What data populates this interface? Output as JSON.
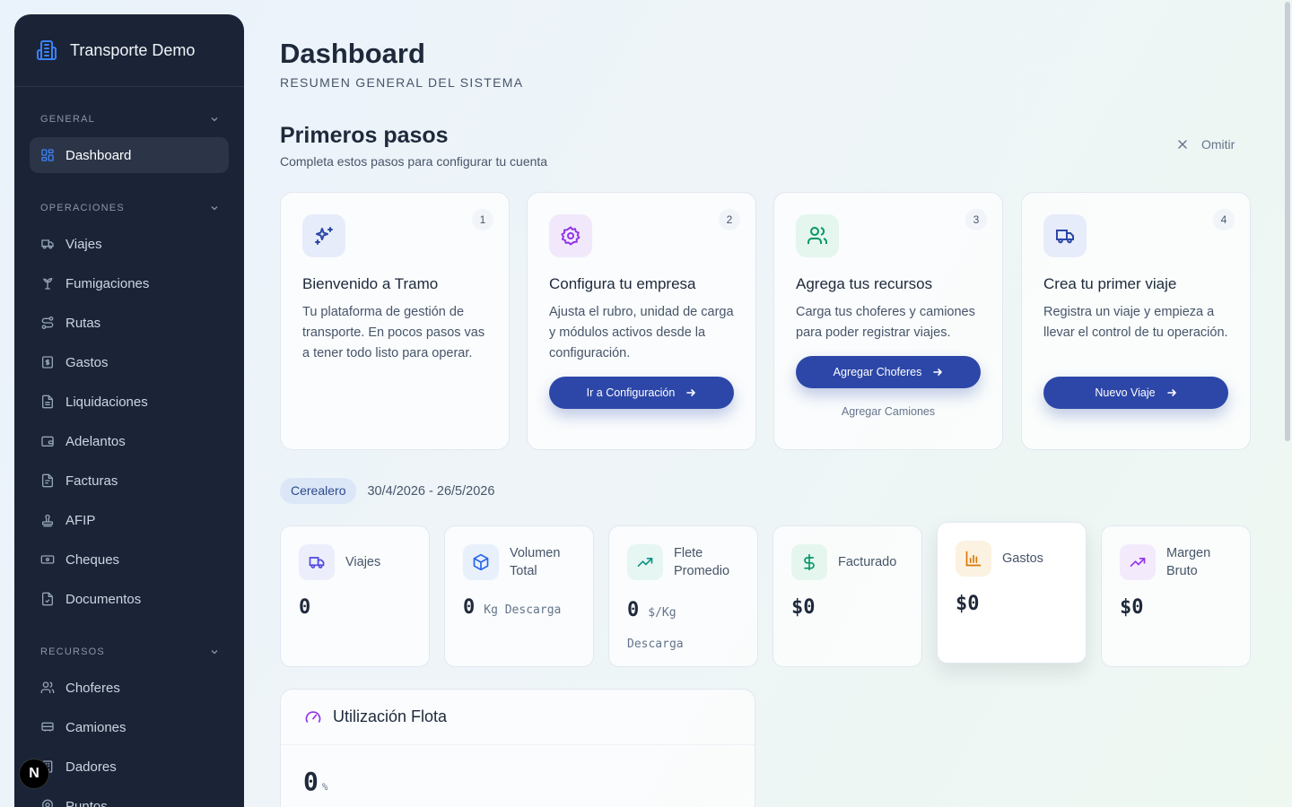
{
  "sidebar": {
    "brand": "Transporte Demo",
    "sections": [
      {
        "title": "GENERAL",
        "items": [
          {
            "label": "Dashboard",
            "icon": "layout-grid-icon",
            "active": true
          }
        ]
      },
      {
        "title": "OPERACIONES",
        "items": [
          {
            "label": "Viajes",
            "icon": "truck-icon"
          },
          {
            "label": "Fumigaciones",
            "icon": "spray-icon"
          },
          {
            "label": "Rutas",
            "icon": "route-icon"
          },
          {
            "label": "Gastos",
            "icon": "receipt-icon"
          },
          {
            "label": "Liquidaciones",
            "icon": "document-icon"
          },
          {
            "label": "Adelantos",
            "icon": "wallet-icon"
          },
          {
            "label": "Facturas",
            "icon": "invoice-icon"
          },
          {
            "label": "AFIP",
            "icon": "stamp-icon"
          },
          {
            "label": "Cheques",
            "icon": "cheque-icon"
          },
          {
            "label": "Documentos",
            "icon": "file-icon"
          }
        ]
      },
      {
        "title": "RECURSOS",
        "items": [
          {
            "label": "Choferes",
            "icon": "users-icon"
          },
          {
            "label": "Camiones",
            "icon": "bus-icon"
          },
          {
            "label": "Dadores",
            "icon": "building-icon"
          },
          {
            "label": "Puntos",
            "icon": "map-pin-icon"
          }
        ]
      }
    ]
  },
  "header": {
    "title": "Dashboard",
    "subtitle": "RESUMEN GENERAL DEL SISTEMA"
  },
  "onboarding": {
    "title": "Primeros pasos",
    "subtitle": "Completa estos pasos para configurar tu cuenta",
    "skip_label": "Omitir",
    "steps": [
      {
        "number": "1",
        "icon": "sparkles-icon",
        "title": "Bienvenido a Tramo",
        "description": "Tu plataforma de gestión de transporte. En pocos pasos vas a tener todo listo para operar."
      },
      {
        "number": "2",
        "icon": "settings-icon",
        "title": "Configura tu empresa",
        "description": "Ajusta el rubro, unidad de carga y módulos activos desde la configuración.",
        "button": "Ir a Configuración"
      },
      {
        "number": "3",
        "icon": "users-icon",
        "title": "Agrega tus recursos",
        "description": "Carga tus choferes y camiones para poder registrar viajes.",
        "button": "Agregar Choferes",
        "secondary_link": "Agregar Camiones"
      },
      {
        "number": "4",
        "icon": "truck-icon",
        "title": "Crea tu primer viaje",
        "description": "Registra un viaje y empieza a llevar el control de tu operación.",
        "button": "Nuevo Viaje"
      }
    ]
  },
  "filters": {
    "category": "Cerealero",
    "date_range": "30/4/2026 - 26/5/2026"
  },
  "stats": [
    {
      "label": "Viajes",
      "value": "0",
      "unit": "",
      "icon": "truck-icon",
      "color": "#4f46e5"
    },
    {
      "label": "Volumen Total",
      "value": "0",
      "unit": "Kg Descarga",
      "icon": "box-icon",
      "color": "#2563eb"
    },
    {
      "label": "Flete Promedio",
      "value": "0",
      "unit": "$/Kg Descarga",
      "icon": "trending-up-icon",
      "color": "#0d9488"
    },
    {
      "label": "Facturado",
      "value": "$0",
      "unit": "",
      "icon": "dollar-icon",
      "color": "#059669"
    },
    {
      "label": "Gastos",
      "value": "$0",
      "unit": "",
      "icon": "bar-chart-icon",
      "color": "#d97706"
    },
    {
      "label": "Margen Bruto",
      "value": "$0",
      "unit": "",
      "icon": "trending-up-icon",
      "color": "#9333ea"
    }
  ],
  "fleet": {
    "title": "Utilización Flota",
    "value": "0",
    "unit": "%",
    "icon": "gauge-icon"
  },
  "dev_badge": "N",
  "colors": {
    "sidebar_bg": "#1b2437",
    "primary_button": "#2c47a8",
    "chip_bg": "#dbe6f7"
  }
}
